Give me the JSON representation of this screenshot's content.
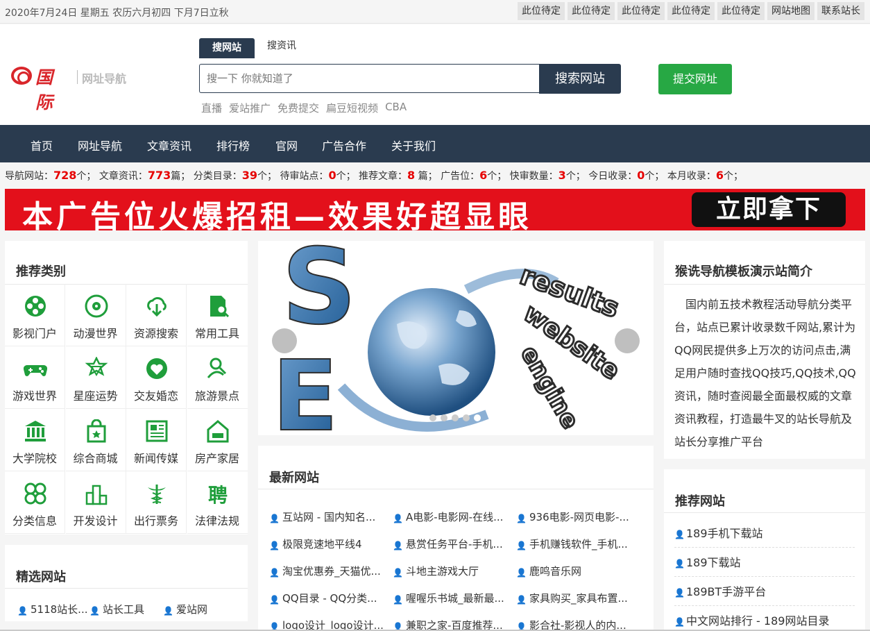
{
  "topbar": {
    "date": "2020年7月24日 星期五 农历六月初四 下月7日立秋",
    "links": [
      "此位待定",
      "此位待定",
      "此位待定",
      "此位待定",
      "此位待定",
      "网站地图",
      "联系站长"
    ]
  },
  "logo": {
    "cn": "国际",
    "sub": "网址导航"
  },
  "search": {
    "tab_active": "搜网站",
    "tab_inactive": "搜资讯",
    "placeholder": "搜一下 你就知道了",
    "button": "搜索网站",
    "hot": [
      "直播",
      "爱站推广",
      "免费提交",
      "扁豆短视频",
      "CBA"
    ],
    "submit": "提交网址"
  },
  "nav": [
    "首页",
    "网址导航",
    "文章资讯",
    "排行榜",
    "官网",
    "广告合作",
    "关于我们"
  ],
  "stats": {
    "sites_label": "导航网站：",
    "sites": "728",
    "sites_unit": "个；",
    "articles_label": "文章资讯：",
    "articles": "773",
    "articles_unit": "篇；",
    "cats_label": "分类目录：",
    "cats": "39",
    "cats_unit": "个；",
    "pending_label": "待审站点：",
    "pending": "0",
    "pending_unit": "个；",
    "rec_label": "推荐文章：",
    "rec": "8",
    "rec_unit": " 篇；",
    "ads_label": "广告位：",
    "ads": "6",
    "ads_unit": "个；",
    "quick_label": "快审数量：",
    "quick": "3",
    "quick_unit": "个；",
    "today_label": "今日收录：",
    "today": "0",
    "today_unit": "个；",
    "month_label": "本月收录：",
    "month": "6",
    "month_unit": "个；"
  },
  "banner": {
    "text": "本广告位火爆招租—效果好超显眼",
    "button": "立即拿下"
  },
  "categories": {
    "title": "推荐类别",
    "items": [
      {
        "label": "影视门户",
        "icon": "film-reel-icon"
      },
      {
        "label": "动漫世界",
        "icon": "disc-icon"
      },
      {
        "label": "资源搜索",
        "icon": "cloud-download-icon"
      },
      {
        "label": "常用工具",
        "icon": "document-search-icon"
      },
      {
        "label": "游戏世界",
        "icon": "gamepad-icon"
      },
      {
        "label": "星座运势",
        "icon": "star-icon"
      },
      {
        "label": "交友婚恋",
        "icon": "heart-icon"
      },
      {
        "label": "旅游景点",
        "icon": "person-search-icon"
      },
      {
        "label": "大学院校",
        "icon": "bank-icon"
      },
      {
        "label": "综合商城",
        "icon": "shopping-bag-icon"
      },
      {
        "label": "新闻传媒",
        "icon": "newspaper-icon"
      },
      {
        "label": "房产家居",
        "icon": "house-sofa-icon"
      },
      {
        "label": "分类信息",
        "icon": "four-leaf-icon"
      },
      {
        "label": "开发设计",
        "icon": "podium-icon"
      },
      {
        "label": "出行票务",
        "icon": "caduceus-icon"
      },
      {
        "label": "法律法规",
        "icon": "pin-character-icon"
      }
    ]
  },
  "featured": {
    "title": "精选网站",
    "items": [
      "5118站长...",
      "站长工具",
      "爱站网"
    ]
  },
  "slider": {
    "prev": "",
    "next": "",
    "dot_count": 5,
    "active_dot": 5,
    "words": [
      "results",
      "website",
      "engine"
    ]
  },
  "latest": {
    "title": "最新网站",
    "items": [
      "互站网 - 国内知名...",
      "A电影-电影网-在线...",
      "936电影-网页电影-...",
      "极限竞速地平线4",
      "悬赏任务平台-手机...",
      "手机赚钱软件_手机...",
      "淘宝优惠券_天猫优...",
      "斗地主游戏大厅",
      "鹿鸣音乐网",
      "QQ目录 - QQ分类...",
      "喔喔乐书城_最新最...",
      "家具购买_家具布置...",
      "logo设计_logo设计...",
      "兼职之家-百度推荐...",
      "影合社-影视人的内..."
    ]
  },
  "intro": {
    "title": "猴诜导航模板演示站简介",
    "text": "国内前五技术教程活动导航分类平台，站点已累计收录数千网站,累计为QQ网民提供多上万次的访问点击,满足用户随时查找QQ技巧,QQ技术,QQ资讯，随时查阅最全面最权威的文章资讯教程，打造最牛叉的站长导航及站长分享推广平台"
  },
  "recommended": {
    "title": "推荐网站",
    "items": [
      "189手机下载站",
      "189下载站",
      "189BT手游平台",
      "中文网站排行 - 189网站目录"
    ]
  },
  "colors": {
    "brand": "#2a3b4f",
    "accent": "#d9262b",
    "green": "#27a844",
    "icon_green": "#1f9e3b",
    "banner": "#e3101b"
  }
}
